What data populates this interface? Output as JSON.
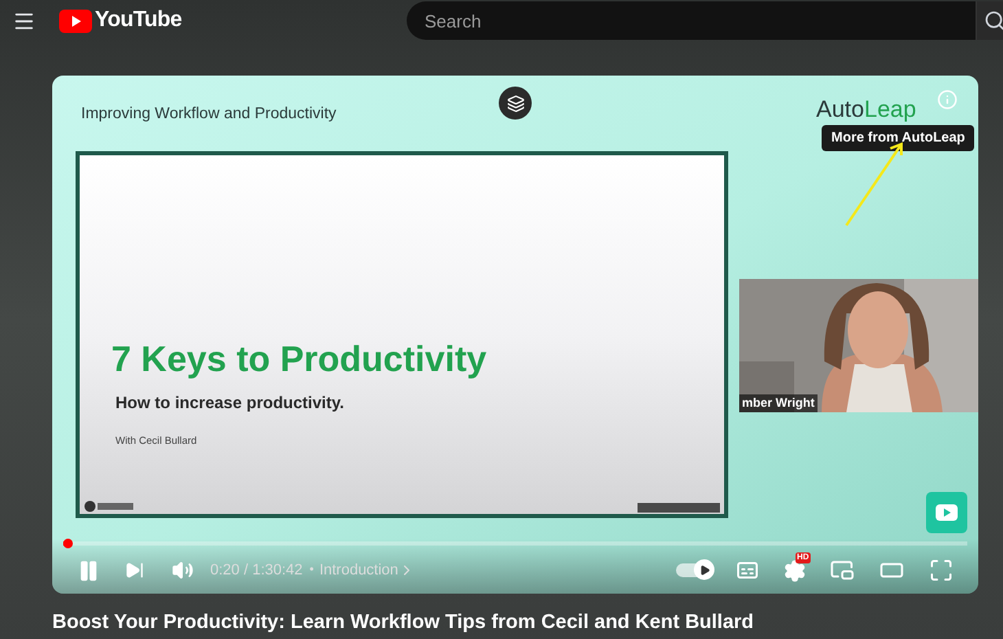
{
  "header": {
    "logo_text": "YouTube",
    "search": {
      "placeholder": "Search"
    }
  },
  "video": {
    "slide_header": "Improving Workflow and Productivity",
    "brand": [
      "Auto",
      "Leap"
    ],
    "tooltip": "More from AutoLeap",
    "slide": {
      "title": "7 Keys to Productivity",
      "subtitle": "How to increase productivity.",
      "presenter": "With Cecil Bullard"
    },
    "webcam": {
      "name_label": "mber Wright"
    }
  },
  "player": {
    "progress": {
      "level": 0.004
    },
    "playing": true,
    "time": "0:20 / 1:30:42",
    "chapter_separator": "•",
    "chapter": "Introduction",
    "autoplay": {
      "on": true
    },
    "captions": {
      "on": false
    },
    "quality_badge": "HD"
  },
  "title": "Boost Your Productivity: Learn Workflow Tips from Cecil and Kent Bullard"
}
